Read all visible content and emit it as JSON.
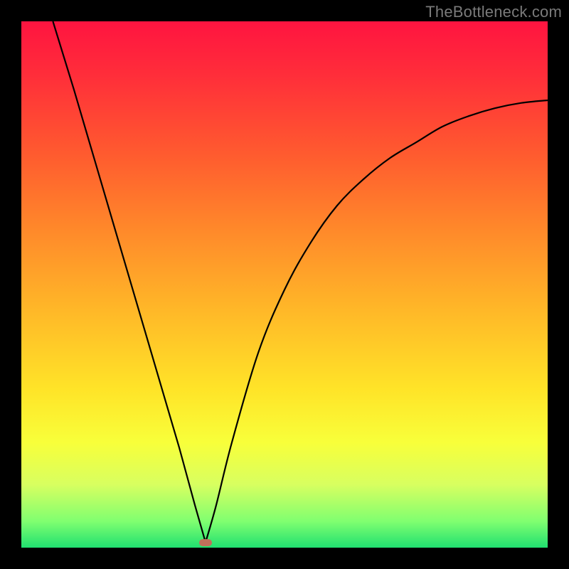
{
  "watermark": "TheBottleneck.com",
  "chart_data": {
    "type": "line",
    "title": "",
    "xlabel": "",
    "ylabel": "",
    "xlim": [
      0,
      100
    ],
    "ylim": [
      0,
      100
    ],
    "grid": false,
    "legend": false,
    "series": [
      {
        "name": "left-branch",
        "x": [
          6,
          10,
          15,
          20,
          25,
          30,
          33,
          35
        ],
        "values": [
          100,
          87,
          70,
          53,
          36,
          19,
          8,
          1
        ]
      },
      {
        "name": "right-branch",
        "x": [
          35,
          37,
          40,
          45,
          50,
          55,
          60,
          65,
          70,
          75,
          80,
          85,
          90,
          95,
          100
        ],
        "values": [
          1,
          8,
          20,
          37,
          49,
          58,
          65,
          70,
          74,
          77,
          80,
          82,
          83.5,
          84.5,
          85
        ]
      }
    ],
    "minimum_point": {
      "x": 35,
      "y": 1
    },
    "background_gradient": {
      "top": "#ff1440",
      "bottom": "#20e070"
    }
  }
}
